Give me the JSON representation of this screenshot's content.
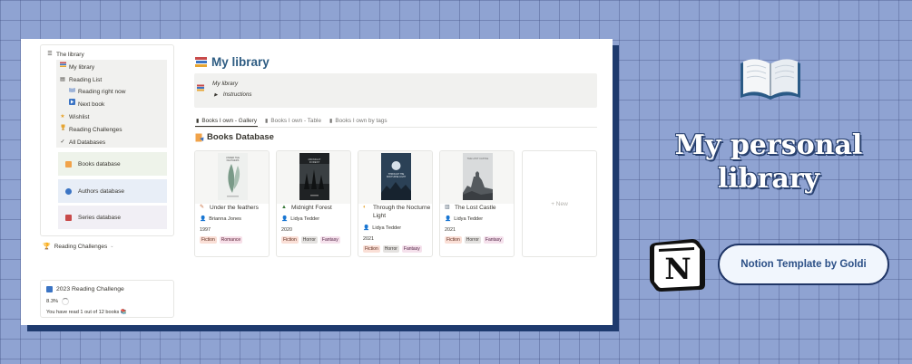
{
  "sidebar": {
    "items": [
      {
        "label": "The library",
        "icon": "list-icon"
      },
      {
        "label": "My library",
        "icon": "books-icon"
      },
      {
        "label": "Reading List",
        "icon": "list-icon"
      },
      {
        "label": "Reading right now",
        "icon": "book-icon"
      },
      {
        "label": "Next book",
        "icon": "next-icon"
      },
      {
        "label": "Wishlist",
        "icon": "star-icon"
      },
      {
        "label": "Reading Challenges",
        "icon": "trophy-icon"
      },
      {
        "label": "All Databases",
        "icon": "check-icon"
      }
    ],
    "databases": [
      {
        "label": "Books database",
        "color": "#f1a34a",
        "bg": "#eef3ea"
      },
      {
        "label": "Authors database",
        "color": "#3b74c4",
        "bg": "#e8eef7"
      },
      {
        "label": "Series database",
        "color": "#c84a4a",
        "bg": "#f1eff5"
      }
    ],
    "challenges_header": "Reading Challenges",
    "challenge": {
      "title": "2023 Reading Challenge",
      "progress": "8.3%",
      "note": "You have read 1 out of 12 books"
    }
  },
  "main": {
    "title": "My library",
    "callout": {
      "line1": "My library",
      "line2": "Instructions"
    },
    "tabs": [
      {
        "label": "Books I own - Gallery",
        "active": true
      },
      {
        "label": "Books I own - Table",
        "active": false
      },
      {
        "label": "Books I own by tags",
        "active": false
      }
    ],
    "section_title": "Books Database",
    "new_label": "+ New",
    "cards": [
      {
        "title": "Under the feathers",
        "icon": "feather-icon",
        "author": "Brianna Jones",
        "year": "1997",
        "tags": [
          "Fiction",
          "Romance"
        ],
        "cover_text": "UNDER THE FEATHERS"
      },
      {
        "title": "Midnight Forest",
        "icon": "tree-icon",
        "author": "Lidya Tedder",
        "year": "2020",
        "tags": [
          "Fiction",
          "Horror",
          "Fantasy"
        ],
        "cover_text": "MIDNIGHT FOREST"
      },
      {
        "title": "Through the Nocturne Light",
        "icon": "moon-icon",
        "author": "Lidya Tedder",
        "year": "2021",
        "tags": [
          "Fiction",
          "Horror",
          "Fantasy"
        ],
        "cover_text": "THROUGH THE NOCTURNE LIGHT"
      },
      {
        "title": "The Lost Castle",
        "icon": "castle-icon",
        "author": "Lidya Tedder",
        "year": "2021",
        "tags": [
          "Fiction",
          "Horror",
          "Fantasy"
        ],
        "cover_text": "THE LOST CASTLE"
      }
    ]
  },
  "promo": {
    "headline_line1": "My personal",
    "headline_line2": "library",
    "pill": "Notion Template by Goldi",
    "notion_letter": "N"
  }
}
